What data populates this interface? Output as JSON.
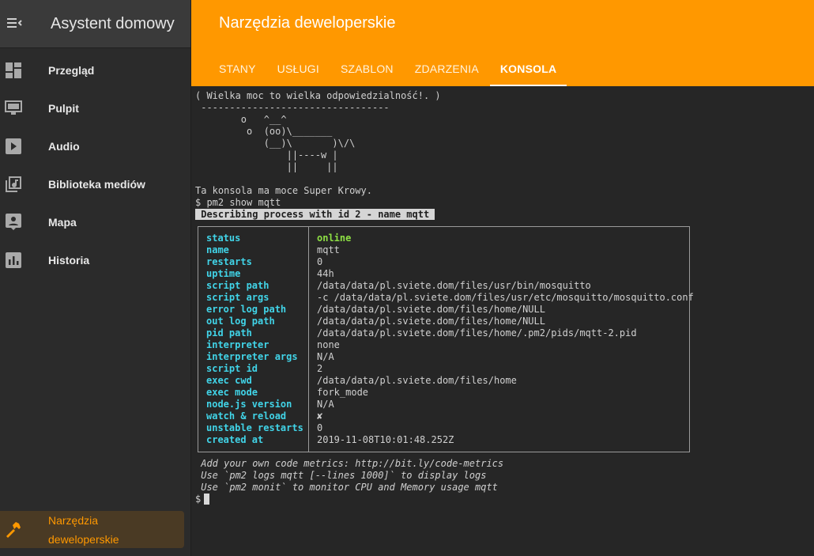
{
  "sidebar": {
    "title": "Asystent domowy",
    "items": [
      {
        "label": "Przegląd",
        "icon": "dashboard-icon"
      },
      {
        "label": "Pulpit",
        "icon": "monitor-icon"
      },
      {
        "label": "Audio",
        "icon": "play-icon"
      },
      {
        "label": "Biblioteka mediów",
        "icon": "media-library-icon"
      },
      {
        "label": "Mapa",
        "icon": "map-person-icon"
      },
      {
        "label": "Historia",
        "icon": "chart-icon"
      }
    ],
    "active_item": {
      "line1": "Narzędzia",
      "line2": "deweloperskie",
      "icon": "hammer-icon"
    }
  },
  "header": {
    "title": "Narzędzia deweloperskie",
    "tabs": [
      "STANY",
      "USŁUGI",
      "SZABLON",
      "ZDARZENIA",
      "KONSOLA"
    ],
    "active_tab": "KONSOLA"
  },
  "console": {
    "cow": [
      "( Wielka moc to wielka odpowiedzialność!. )",
      " ---------------------------------",
      "        o   ^__^",
      "         o  (oo)\\_______",
      "            (__)\\       )\\/\\",
      "                ||----w |",
      "                ||     ||"
    ],
    "super_cow": "Ta konsola ma moce Super Krowy.",
    "command": "$ pm2 show mqtt",
    "describing": " Describing process with id 2 - name mqtt ",
    "process": [
      {
        "key": "status",
        "value": "online"
      },
      {
        "key": "name",
        "value": "mqtt"
      },
      {
        "key": "restarts",
        "value": "0"
      },
      {
        "key": "uptime",
        "value": "44h"
      },
      {
        "key": "script path",
        "value": "/data/data/pl.sviete.dom/files/usr/bin/mosquitto"
      },
      {
        "key": "script args",
        "value": "-c /data/data/pl.sviete.dom/files/usr/etc/mosquitto/mosquitto.conf"
      },
      {
        "key": "error log path",
        "value": "/data/data/pl.sviete.dom/files/home/NULL"
      },
      {
        "key": "out log path",
        "value": "/data/data/pl.sviete.dom/files/home/NULL"
      },
      {
        "key": "pid path",
        "value": "/data/data/pl.sviete.dom/files/home/.pm2/pids/mqtt-2.pid"
      },
      {
        "key": "interpreter",
        "value": "none"
      },
      {
        "key": "interpreter args",
        "value": "N/A"
      },
      {
        "key": "script id",
        "value": "2"
      },
      {
        "key": "exec cwd",
        "value": "/data/data/pl.sviete.dom/files/home"
      },
      {
        "key": "exec mode",
        "value": "fork_mode"
      },
      {
        "key": "node.js version",
        "value": "N/A"
      },
      {
        "key": "watch & reload",
        "value": "✘"
      },
      {
        "key": "unstable restarts",
        "value": "0"
      },
      {
        "key": "created at",
        "value": "2019-11-08T10:01:48.252Z"
      }
    ],
    "footer": [
      " Add your own code metrics: http://bit.ly/code-metrics",
      " Use `pm2 logs mqtt [--lines 1000]` to display logs",
      " Use `pm2 monit` to monitor CPU and Memory usage mqtt"
    ],
    "prompt": "$"
  },
  "colors": {
    "accent": "#ff9800",
    "key": "#41d4e8",
    "online": "#8ee044"
  }
}
